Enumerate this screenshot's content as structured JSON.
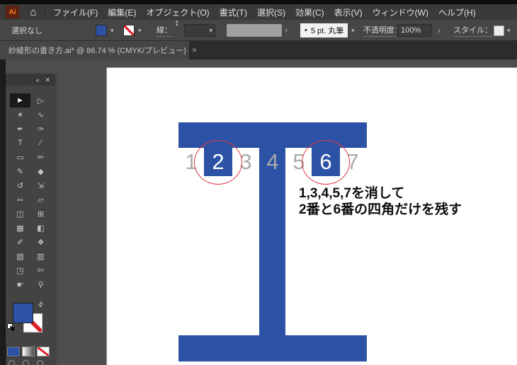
{
  "app": {
    "logo": "Ai"
  },
  "menu": {
    "items": [
      "ファイル(F)",
      "編集(E)",
      "オブジェクト(O)",
      "書式(T)",
      "選択(S)",
      "効果(C)",
      "表示(V)",
      "ウィンドウ(W)",
      "ヘルプ(H)"
    ]
  },
  "control_bar": {
    "selection_status": "選択なし",
    "fill_color": "#2B52A4",
    "stroke_label": "線：",
    "brush_bullet": "•",
    "brush_name": "5 pt. 丸筆",
    "opacity_label": "不透明度：",
    "opacity_value": "100%",
    "style_label": "スタイル："
  },
  "document_tab": {
    "title": "紗綾形の書き方.ai* @ 86.74 % (CMYK/プレビュー)"
  },
  "icons": {
    "home": "⌂",
    "collapse": "«",
    "close": "✕",
    "chevron_down": "▾",
    "chevron_up": "▴",
    "chevron_right": "›",
    "swap": "⇄",
    "handle_dots": "·····"
  },
  "toolbar": {
    "tools": [
      {
        "name": "selection",
        "glyph": "►"
      },
      {
        "name": "direct-selection",
        "glyph": "▷"
      },
      {
        "name": "magic-wand",
        "glyph": "✶"
      },
      {
        "name": "lasso",
        "glyph": "∿"
      },
      {
        "name": "pen",
        "glyph": "✒"
      },
      {
        "name": "curvature",
        "glyph": "✑"
      },
      {
        "name": "type",
        "glyph": "T"
      },
      {
        "name": "line-segment",
        "glyph": "∕"
      },
      {
        "name": "rectangle",
        "glyph": "▭"
      },
      {
        "name": "paintbrush",
        "glyph": "✏"
      },
      {
        "name": "pencil",
        "glyph": "✎"
      },
      {
        "name": "eraser",
        "glyph": "◆"
      },
      {
        "name": "rotate",
        "glyph": "↺"
      },
      {
        "name": "scale",
        "glyph": "⇲"
      },
      {
        "name": "width",
        "glyph": "∾"
      },
      {
        "name": "free-transform",
        "glyph": "▱"
      },
      {
        "name": "shape-builder",
        "glyph": "◫"
      },
      {
        "name": "perspective-grid",
        "glyph": "⊞"
      },
      {
        "name": "mesh",
        "glyph": "▦"
      },
      {
        "name": "gradient",
        "glyph": "◧"
      },
      {
        "name": "eyedropper",
        "glyph": "✐"
      },
      {
        "name": "blend",
        "glyph": "❖"
      },
      {
        "name": "symbol-sprayer",
        "glyph": "▨"
      },
      {
        "name": "column-graph",
        "glyph": "▥"
      },
      {
        "name": "artboard",
        "glyph": "◳"
      },
      {
        "name": "slice",
        "glyph": "✄"
      },
      {
        "name": "hand",
        "glyph": "☛"
      },
      {
        "name": "zoom",
        "glyph": "⚲"
      }
    ]
  },
  "canvas": {
    "shape_color": "#2B52A4",
    "circle_color": "#E23440",
    "numbers": [
      "1",
      "2",
      "3",
      "4",
      "5",
      "6",
      "7"
    ],
    "annotation": {
      "line1": "1,3,4,5,7を消して",
      "line2": "2番と6番の四角だけを残す"
    }
  }
}
